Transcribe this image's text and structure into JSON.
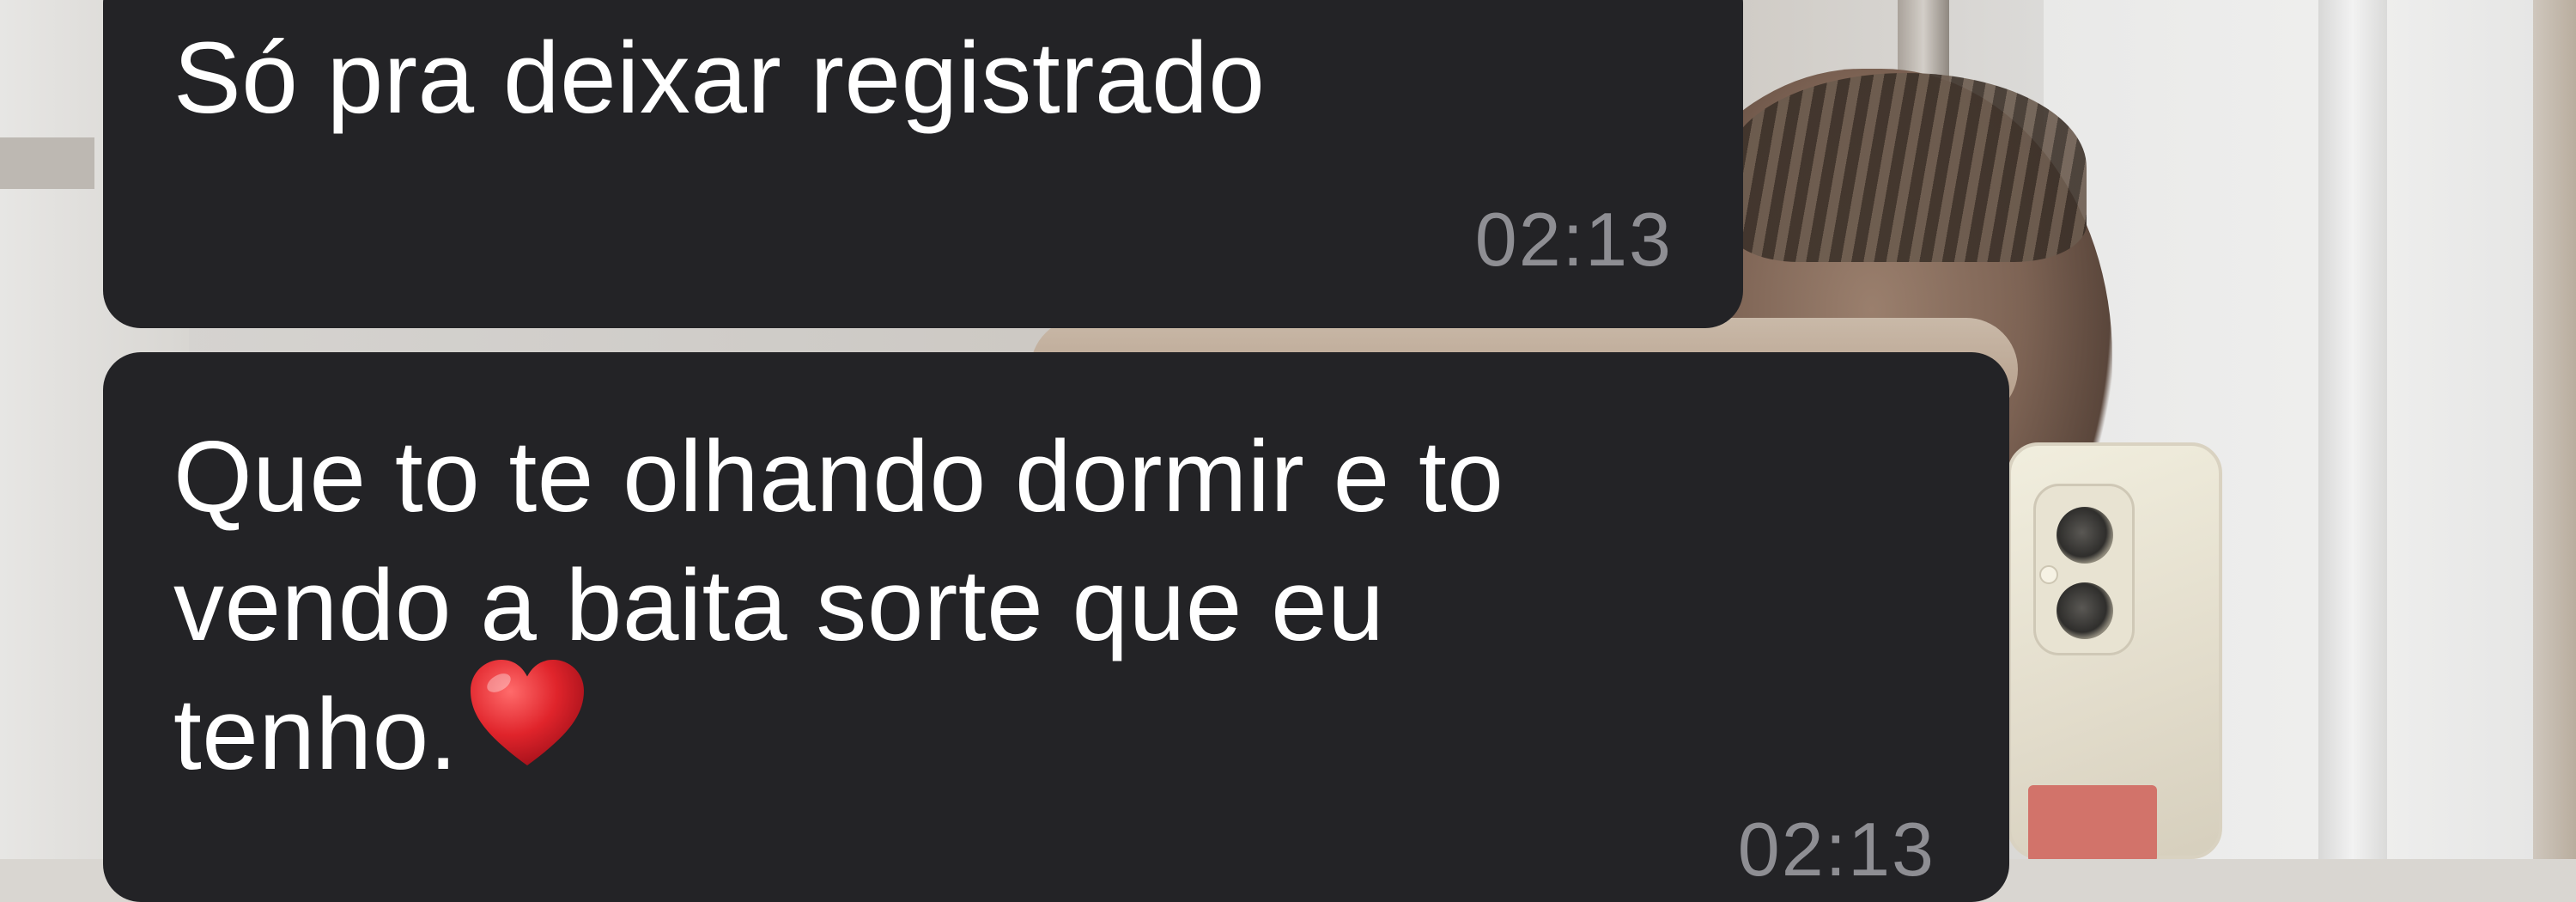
{
  "messages": [
    {
      "text": "Só pra deixar registrado",
      "time": "02:13"
    },
    {
      "text": "Que to te olhando dormir e to\nvendo a baita sorte que eu\ntenho.",
      "time": "02:13",
      "emoji": "red-heart-emoji"
    }
  ],
  "colors": {
    "bubble": "#232326",
    "text": "#ffffff",
    "timestamp": "#8e8e93",
    "heart": "#e0242b"
  }
}
